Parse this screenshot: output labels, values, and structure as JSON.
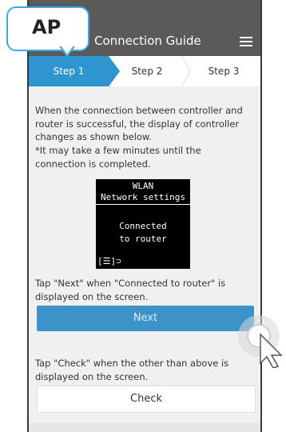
{
  "header": {
    "title": "Connection Guide"
  },
  "badge": {
    "text": "AP"
  },
  "steps": [
    {
      "label": "Step 1"
    },
    {
      "label": "Step 2"
    },
    {
      "label": "Step 3"
    }
  ],
  "content": {
    "para1": "When the connection between controller and router is successful, the display of controller changes as shown below.",
    "note": "*It may take a few minutes until the connection is completed.",
    "para2": "Tap \"Next\" when \"Connected to router\" is displayed on the screen.",
    "next_label": "Next",
    "para3": "Tap \"Check\" when the other than above is displayed on the screen.",
    "check_label": "Check"
  },
  "lcd": {
    "line1": "WLAN",
    "line2": "Network settings",
    "line3": "Connected",
    "line4": "to router",
    "line5": "[☰]⊃"
  },
  "colors": {
    "accent": "#2e95d0",
    "button": "#3b93c8",
    "header": "#5a5a5a"
  }
}
